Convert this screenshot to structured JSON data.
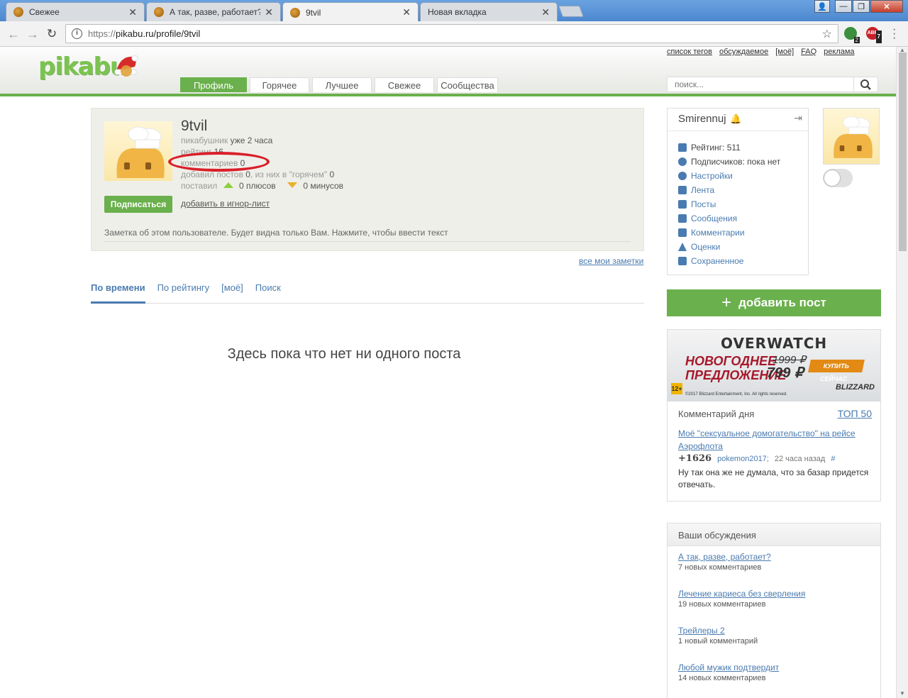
{
  "browser": {
    "tabs": [
      {
        "label": "Свежее"
      },
      {
        "label": "А так, разве, работает?"
      },
      {
        "label": "9tvil"
      },
      {
        "label": "Новая вкладка"
      }
    ],
    "url_proto": "https://",
    "url_rest": "pikabu.ru/profile/9tvil",
    "ext_badges": [
      "2",
      "7"
    ],
    "ext_abp": "ABP"
  },
  "header": {
    "logo": "pikabu",
    "toplinks": [
      "список тегов",
      "обсуждаемое",
      "[моё]",
      "FAQ",
      "реклама"
    ],
    "nav": [
      "Профиль",
      "Горячее",
      "Лучшее",
      "Свежее",
      "Сообщества"
    ],
    "search_placeholder": "поиск..."
  },
  "profile": {
    "username": "9tvil",
    "since_label": "пикабушник",
    "since_value": "уже 2 часа",
    "rating_label": "рейтинг",
    "rating_value": "16",
    "comments_label": "комментариев",
    "comments_value": "0",
    "posts_label": "добавил постов",
    "posts_value": "0",
    "hot_label": ", из них в \"горячем\"",
    "hot_value": "0",
    "voted_label": "поставил",
    "plus_text": "0 плюсов",
    "minus_text": "0 минусов",
    "subscribe_btn": "Подписаться",
    "ignore_link": "добавить в игнор-лист",
    "note": "Заметка об этом пользователе. Будет видна только Вам. Нажмите, чтобы ввести текст"
  },
  "all_notes": "все мои заметки",
  "sort_tabs": [
    "По времени",
    "По рейтингу",
    "[моё]",
    "Поиск"
  ],
  "empty_message": "Здесь пока что нет ни одного поста",
  "sidebar": {
    "current_user": "Smirennuj",
    "menu": [
      {
        "label": "Рейтинг: 511",
        "plain": true
      },
      {
        "label": "Подписчиков: пока нет",
        "plain": true
      },
      {
        "label": "Настройки"
      },
      {
        "label": "Лента"
      },
      {
        "label": "Посты"
      },
      {
        "label": "Сообщения"
      },
      {
        "label": "Комментарии"
      },
      {
        "label": "Оценки"
      },
      {
        "label": "Сохраненное"
      }
    ],
    "add_post": "добавить пост",
    "banner": {
      "brand": "OVERWATCH",
      "offer_line1": "НОВОГОДНЕЕ",
      "offer_line2": "ПРЕДЛОЖЕНИЕ",
      "old_price": "1999 ₽",
      "new_price": "799 ₽",
      "buy": "КУПИТЬ СЕЙЧАС",
      "age": "12+",
      "copyright": "©2017 Blizzard Entertainment, Inc. All rights reserved.",
      "publisher": "BLIZZARD"
    },
    "comment_of_day": {
      "title": "Комментарий дня",
      "top": "ТОП 50",
      "post_link": "Моё \"сексуальное домогательство\" на рейсе Аэрофлота",
      "score": "+1626",
      "author": "pokemon2017;",
      "time": "22 часа назад",
      "hash": "#",
      "text": "Ну так она же не думала, что за базар придется отвечать."
    },
    "discussions": {
      "title": "Ваши обсуждения",
      "items": [
        {
          "title": "А так, разве, работает?",
          "count": "7 новых комментариев"
        },
        {
          "title": "Лечение кариеса без сверления",
          "count": "19 новых комментариев"
        },
        {
          "title": "Трейлеры 2",
          "count": "1 новый комментарий"
        },
        {
          "title": "Любой мужик подтвердит",
          "count": "14 новых комментариев"
        }
      ]
    }
  },
  "colors": {
    "brand_green": "#6ab04c",
    "link_blue": "#4a7bb0",
    "annotation_red": "#d9202a"
  }
}
